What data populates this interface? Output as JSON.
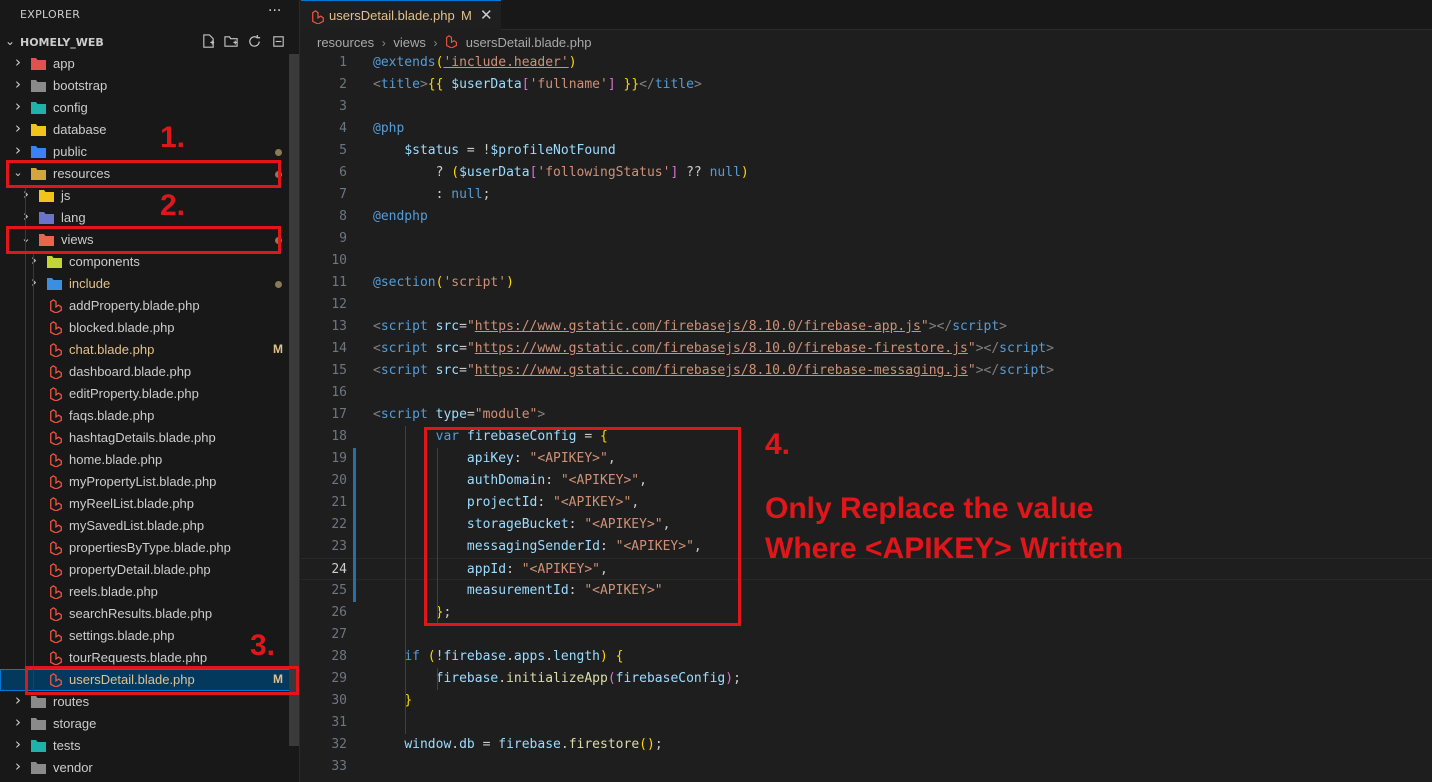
{
  "explorer": {
    "title": "EXPLORER",
    "more": "···",
    "project": "HOMELY_WEB",
    "actions": [
      "new-file-icon",
      "new-folder-icon",
      "refresh-icon",
      "collapse-all-icon"
    ],
    "tree": [
      {
        "name": "app",
        "type": "folder",
        "depth": 0,
        "expanded": false,
        "icon_color": "#e05252"
      },
      {
        "name": "bootstrap",
        "type": "folder",
        "depth": 0,
        "expanded": false,
        "icon_color": "#8a8a8a"
      },
      {
        "name": "config",
        "type": "folder",
        "depth": 0,
        "expanded": false,
        "icon_color": "#20b2aa"
      },
      {
        "name": "database",
        "type": "folder",
        "depth": 0,
        "expanded": false,
        "icon_color": "#f0c419"
      },
      {
        "name": "public",
        "type": "folder",
        "depth": 0,
        "expanded": false,
        "icon_color": "#3b82f6",
        "dot": true
      },
      {
        "name": "resources",
        "type": "folder",
        "depth": 0,
        "expanded": true,
        "icon_color": "#d4a53a",
        "dot": true
      },
      {
        "name": "js",
        "type": "folder",
        "depth": 1,
        "expanded": false,
        "icon_color": "#f0c419"
      },
      {
        "name": "lang",
        "type": "folder",
        "depth": 1,
        "expanded": false,
        "icon_color": "#6b74c8"
      },
      {
        "name": "views",
        "type": "folder",
        "depth": 1,
        "expanded": true,
        "icon_color": "#e8664b",
        "dot": true
      },
      {
        "name": "components",
        "type": "folder",
        "depth": 2,
        "expanded": false,
        "icon_color": "#c3d43a"
      },
      {
        "name": "include",
        "type": "folder",
        "depth": 2,
        "expanded": false,
        "icon_color": "#3b8fe0",
        "dot": true,
        "modified": true
      },
      {
        "name": "addProperty.blade.php",
        "type": "file",
        "depth": 2
      },
      {
        "name": "blocked.blade.php",
        "type": "file",
        "depth": 2
      },
      {
        "name": "chat.blade.php",
        "type": "file",
        "depth": 2,
        "modified": true,
        "mark": "M"
      },
      {
        "name": "dashboard.blade.php",
        "type": "file",
        "depth": 2
      },
      {
        "name": "editProperty.blade.php",
        "type": "file",
        "depth": 2
      },
      {
        "name": "faqs.blade.php",
        "type": "file",
        "depth": 2
      },
      {
        "name": "hashtagDetails.blade.php",
        "type": "file",
        "depth": 2
      },
      {
        "name": "home.blade.php",
        "type": "file",
        "depth": 2
      },
      {
        "name": "myPropertyList.blade.php",
        "type": "file",
        "depth": 2
      },
      {
        "name": "myReelList.blade.php",
        "type": "file",
        "depth": 2
      },
      {
        "name": "mySavedList.blade.php",
        "type": "file",
        "depth": 2
      },
      {
        "name": "propertiesByType.blade.php",
        "type": "file",
        "depth": 2
      },
      {
        "name": "propertyDetail.blade.php",
        "type": "file",
        "depth": 2
      },
      {
        "name": "reels.blade.php",
        "type": "file",
        "depth": 2
      },
      {
        "name": "searchResults.blade.php",
        "type": "file",
        "depth": 2
      },
      {
        "name": "settings.blade.php",
        "type": "file",
        "depth": 2
      },
      {
        "name": "tourRequests.blade.php",
        "type": "file",
        "depth": 2
      },
      {
        "name": "usersDetail.blade.php",
        "type": "file",
        "depth": 2,
        "modified": true,
        "mark": "M",
        "selected": true
      },
      {
        "name": "routes",
        "type": "folder",
        "depth": 0,
        "expanded": false,
        "icon_color": "#8a8a8a"
      },
      {
        "name": "storage",
        "type": "folder",
        "depth": 0,
        "expanded": false,
        "icon_color": "#8a8a8a"
      },
      {
        "name": "tests",
        "type": "folder",
        "depth": 0,
        "expanded": false,
        "icon_color": "#20b2aa"
      },
      {
        "name": "vendor",
        "type": "folder",
        "depth": 0,
        "expanded": false,
        "icon_color": "#8a8a8a"
      }
    ]
  },
  "tab": {
    "label": "usersDetail.blade.php",
    "mark": "M",
    "close": "✕"
  },
  "breadcrumb": [
    "resources",
    "views",
    "usersDetail.blade.php"
  ],
  "code_lines": [
    [
      [
        "dir",
        "@extends"
      ],
      [
        "br1",
        "("
      ],
      [
        "str url",
        "'include.header'"
      ],
      [
        "br1",
        ")"
      ]
    ],
    [
      [
        "tagb",
        "<"
      ],
      [
        "tag",
        "title"
      ],
      [
        "tagb",
        ">"
      ],
      [
        "br1",
        "{{"
      ],
      [
        "plain",
        " "
      ],
      [
        "var",
        "$userData"
      ],
      [
        "br2",
        "["
      ],
      [
        "str",
        "'fullname'"
      ],
      [
        "br2",
        "]"
      ],
      [
        "plain",
        " "
      ],
      [
        "br1",
        "}}"
      ],
      [
        "tagb",
        "</"
      ],
      [
        "tag",
        "title"
      ],
      [
        "tagb",
        ">"
      ]
    ],
    [],
    [
      [
        "dir",
        "@php"
      ]
    ],
    [
      [
        "plain",
        "    "
      ],
      [
        "var",
        "$status"
      ],
      [
        "plain",
        " = !"
      ],
      [
        "var",
        "$profileNotFound"
      ]
    ],
    [
      [
        "plain",
        "        ? "
      ],
      [
        "br1",
        "("
      ],
      [
        "var",
        "$userData"
      ],
      [
        "br2",
        "["
      ],
      [
        "str",
        "'followingStatus'"
      ],
      [
        "br2",
        "]"
      ],
      [
        "plain",
        " ?? "
      ],
      [
        "kw",
        "null"
      ],
      [
        "br1",
        ")"
      ]
    ],
    [
      [
        "plain",
        "        : "
      ],
      [
        "kw",
        "null"
      ],
      [
        "plain",
        ";"
      ]
    ],
    [
      [
        "dir",
        "@endphp"
      ]
    ],
    [],
    [],
    [
      [
        "dir",
        "@section"
      ],
      [
        "br1",
        "("
      ],
      [
        "str",
        "'script'"
      ],
      [
        "br1",
        ")"
      ]
    ],
    [],
    [
      [
        "tagb",
        "<"
      ],
      [
        "tag",
        "script"
      ],
      [
        "plain",
        " "
      ],
      [
        "attr",
        "src"
      ],
      [
        "plain",
        "="
      ],
      [
        "str",
        "\""
      ],
      [
        "str url",
        "https://www.gstatic.com/firebasejs/8.10.0/firebase-app.js"
      ],
      [
        "str",
        "\""
      ],
      [
        "tagb",
        "></"
      ],
      [
        "tag",
        "script"
      ],
      [
        "tagb",
        ">"
      ]
    ],
    [
      [
        "tagb",
        "<"
      ],
      [
        "tag",
        "script"
      ],
      [
        "plain",
        " "
      ],
      [
        "attr",
        "src"
      ],
      [
        "plain",
        "="
      ],
      [
        "str",
        "\""
      ],
      [
        "str url",
        "https://www.gstatic.com/firebasejs/8.10.0/firebase-firestore.js"
      ],
      [
        "str",
        "\""
      ],
      [
        "tagb",
        "></"
      ],
      [
        "tag",
        "script"
      ],
      [
        "tagb",
        ">"
      ]
    ],
    [
      [
        "tagb",
        "<"
      ],
      [
        "tag",
        "script"
      ],
      [
        "plain",
        " "
      ],
      [
        "attr",
        "src"
      ],
      [
        "plain",
        "="
      ],
      [
        "str",
        "\""
      ],
      [
        "str url",
        "https://www.gstatic.com/firebasejs/8.10.0/firebase-messaging.js"
      ],
      [
        "str",
        "\""
      ],
      [
        "tagb",
        "></"
      ],
      [
        "tag",
        "script"
      ],
      [
        "tagb",
        ">"
      ]
    ],
    [],
    [
      [
        "tagb",
        "<"
      ],
      [
        "tag",
        "script"
      ],
      [
        "plain",
        " "
      ],
      [
        "attr",
        "type"
      ],
      [
        "plain",
        "="
      ],
      [
        "str",
        "\"module\""
      ],
      [
        "tagb",
        ">"
      ]
    ],
    [
      [
        "plain",
        "        "
      ],
      [
        "kw",
        "var"
      ],
      [
        "plain",
        " "
      ],
      [
        "var",
        "firebaseConfig"
      ],
      [
        "plain",
        " = "
      ],
      [
        "br1",
        "{"
      ]
    ],
    [
      [
        "plain",
        "            "
      ],
      [
        "var",
        "apiKey"
      ],
      [
        "plain",
        ": "
      ],
      [
        "str",
        "\"<APIKEY>\""
      ],
      [
        "plain",
        ","
      ]
    ],
    [
      [
        "plain",
        "            "
      ],
      [
        "var",
        "authDomain"
      ],
      [
        "plain",
        ": "
      ],
      [
        "str",
        "\"<APIKEY>\""
      ],
      [
        "plain",
        ","
      ]
    ],
    [
      [
        "plain",
        "            "
      ],
      [
        "var",
        "projectId"
      ],
      [
        "plain",
        ": "
      ],
      [
        "str",
        "\"<APIKEY>\""
      ],
      [
        "plain",
        ","
      ]
    ],
    [
      [
        "plain",
        "            "
      ],
      [
        "var",
        "storageBucket"
      ],
      [
        "plain",
        ": "
      ],
      [
        "str",
        "\"<APIKEY>\""
      ],
      [
        "plain",
        ","
      ]
    ],
    [
      [
        "plain",
        "            "
      ],
      [
        "var",
        "messagingSenderId"
      ],
      [
        "plain",
        ": "
      ],
      [
        "str",
        "\"<APIKEY>\""
      ],
      [
        "plain",
        ","
      ]
    ],
    [
      [
        "plain",
        "            "
      ],
      [
        "var",
        "appId"
      ],
      [
        "plain",
        ": "
      ],
      [
        "str",
        "\"<APIKEY>\""
      ],
      [
        "plain",
        ","
      ]
    ],
    [
      [
        "plain",
        "            "
      ],
      [
        "var",
        "measurementId"
      ],
      [
        "plain",
        ": "
      ],
      [
        "str",
        "\"<APIKEY>\""
      ]
    ],
    [
      [
        "plain",
        "        "
      ],
      [
        "br1",
        "}"
      ],
      [
        "plain",
        ";"
      ]
    ],
    [],
    [
      [
        "plain",
        "    "
      ],
      [
        "kw",
        "if"
      ],
      [
        "plain",
        " "
      ],
      [
        "br1",
        "("
      ],
      [
        "plain",
        "!"
      ],
      [
        "var",
        "firebase"
      ],
      [
        "plain",
        "."
      ],
      [
        "var",
        "apps"
      ],
      [
        "plain",
        "."
      ],
      [
        "var",
        "length"
      ],
      [
        "br1",
        ")"
      ],
      [
        "plain",
        " "
      ],
      [
        "br1",
        "{"
      ]
    ],
    [
      [
        "plain",
        "        "
      ],
      [
        "var",
        "firebase"
      ],
      [
        "plain",
        "."
      ],
      [
        "fn",
        "initializeApp"
      ],
      [
        "br2",
        "("
      ],
      [
        "var",
        "firebaseConfig"
      ],
      [
        "br2",
        ")"
      ],
      [
        "plain",
        ";"
      ]
    ],
    [
      [
        "plain",
        "    "
      ],
      [
        "br1",
        "}"
      ]
    ],
    [],
    [
      [
        "plain",
        "    "
      ],
      [
        "var",
        "window"
      ],
      [
        "plain",
        "."
      ],
      [
        "var",
        "db"
      ],
      [
        "plain",
        " = "
      ],
      [
        "var",
        "firebase"
      ],
      [
        "plain",
        "."
      ],
      [
        "fn",
        "firestore"
      ],
      [
        "br1",
        "()"
      ],
      [
        "plain",
        ";"
      ]
    ],
    []
  ],
  "current_line": 24,
  "annotations": {
    "n1": "1.",
    "n2": "2.",
    "n3": "3.",
    "n4": "4.",
    "note_line1": "Only Replace the value",
    "note_line2": "Where <APIKEY> Written"
  },
  "colors": {
    "annotation": "#e0161b",
    "accent": "#0078d4",
    "modified": "#e2c08d"
  }
}
